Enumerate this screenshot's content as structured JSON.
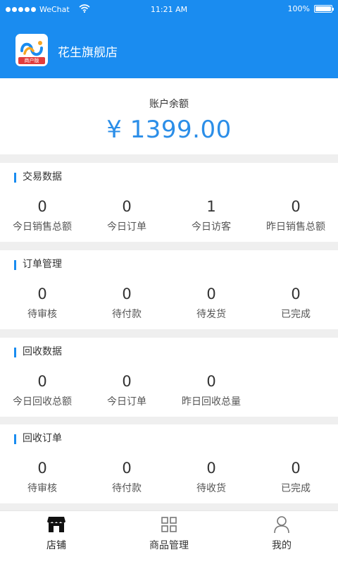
{
  "status_bar": {
    "carrier": "WeChat",
    "time": "11:21 AM",
    "battery": "100%"
  },
  "header": {
    "shop_name": "花生旗舰店",
    "logo_badge": "商户版"
  },
  "balance": {
    "label": "账户余额",
    "amount": "¥ 1399.00"
  },
  "sections": [
    {
      "title": "交易数据",
      "stats": [
        {
          "value": "0",
          "label": "今日销售总额"
        },
        {
          "value": "0",
          "label": "今日订单"
        },
        {
          "value": "1",
          "label": "今日访客"
        },
        {
          "value": "0",
          "label": "昨日销售总额"
        }
      ]
    },
    {
      "title": "订单管理",
      "stats": [
        {
          "value": "0",
          "label": "待审核"
        },
        {
          "value": "0",
          "label": "待付款"
        },
        {
          "value": "0",
          "label": "待发货"
        },
        {
          "value": "0",
          "label": "已完成"
        }
      ]
    },
    {
      "title": "回收数据",
      "stats": [
        {
          "value": "0",
          "label": "今日回收总额"
        },
        {
          "value": "0",
          "label": "今日订单"
        },
        {
          "value": "0",
          "label": "昨日回收总量"
        }
      ]
    },
    {
      "title": "回收订单",
      "stats": [
        {
          "value": "0",
          "label": "待审核"
        },
        {
          "value": "0",
          "label": "待付款"
        },
        {
          "value": "0",
          "label": "待收货"
        },
        {
          "value": "0",
          "label": "已完成"
        }
      ]
    }
  ],
  "tabbar": [
    {
      "label": "店铺",
      "icon": "store-icon",
      "active": true
    },
    {
      "label": "商品管理",
      "icon": "grid-icon",
      "active": false
    },
    {
      "label": "我的",
      "icon": "user-icon",
      "active": false
    }
  ],
  "colors": {
    "primary": "#1a8cf0",
    "amount": "#2b8ee8",
    "background": "#efefef"
  }
}
